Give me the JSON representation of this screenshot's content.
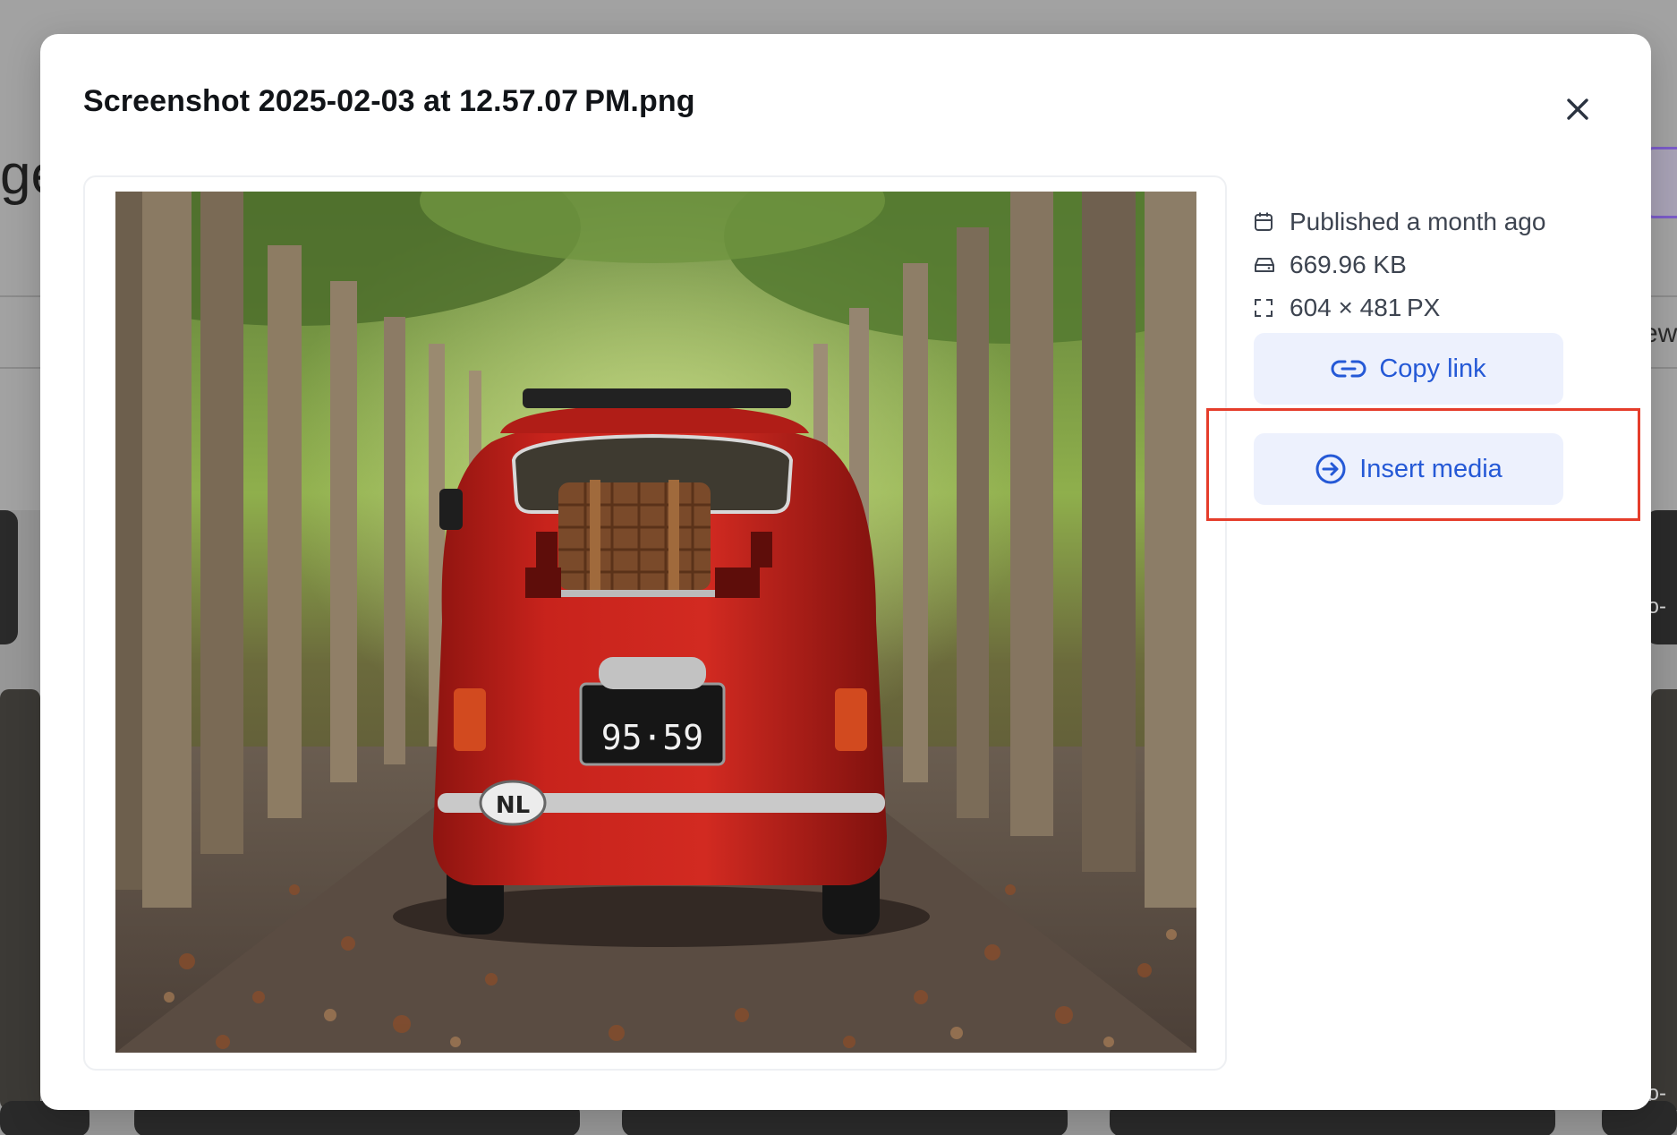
{
  "modal": {
    "title": "Screenshot 2025-02-03 at 12.57.07 PM.png",
    "close_icon": "close-icon"
  },
  "image": {
    "alt": "Red vintage car with a wicker basket on a tree-lined road covered in autumn leaves",
    "plate_text": "95·59",
    "country_badge": "NL"
  },
  "meta": {
    "published": "Published a month ago",
    "size": "669.96 KB",
    "dimensions": "604 × 481 PX",
    "icons": [
      "calendar-icon",
      "drive-icon",
      "dimensions-icon"
    ]
  },
  "actions": {
    "copy_link": "Copy link",
    "insert_media": "Insert media",
    "copy_icon": "link-icon",
    "insert_icon": "arrow-right-circle-icon"
  },
  "background": {
    "title_fragment": "ge",
    "right_fragment_1": "ew",
    "right_fragment_2": "to-",
    "right_fragment_3": "to-"
  },
  "colors": {
    "accent": "#2559d6",
    "button_bg": "#edf1fd",
    "highlight": "#e53d2b"
  }
}
